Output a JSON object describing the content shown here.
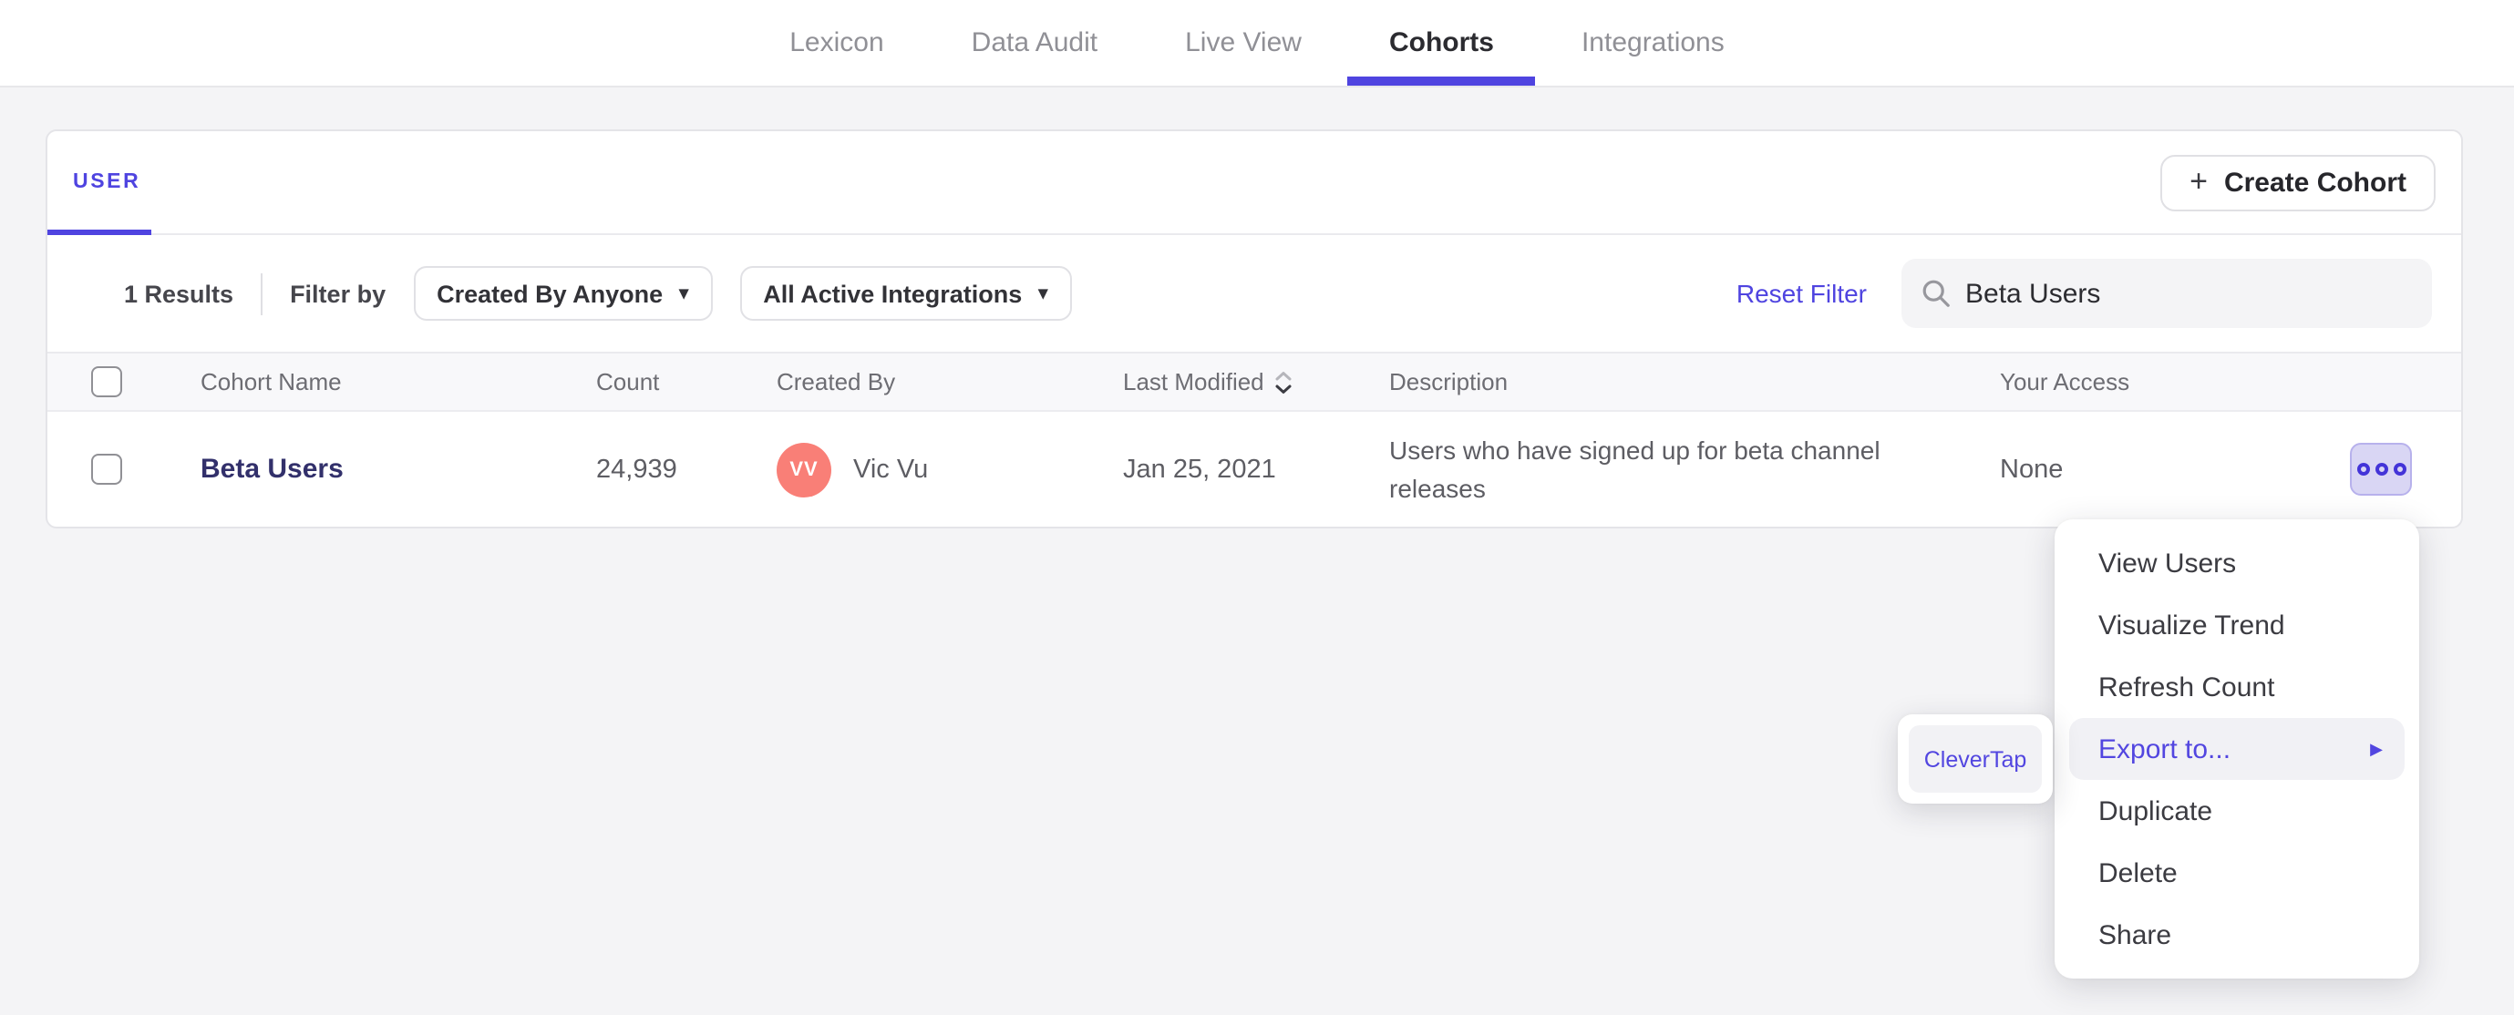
{
  "nav": {
    "items": [
      {
        "label": "Lexicon",
        "active": false
      },
      {
        "label": "Data Audit",
        "active": false
      },
      {
        "label": "Live View",
        "active": false
      },
      {
        "label": "Cohorts",
        "active": true
      },
      {
        "label": "Integrations",
        "active": false
      }
    ]
  },
  "cohorts_card": {
    "tabs": {
      "user_label": "USER"
    },
    "create_button": {
      "plus": "+",
      "label": "Create Cohort"
    },
    "filter_bar": {
      "results_text": "1 Results",
      "filter_by_label": "Filter by",
      "created_by_dropdown": "Created By Anyone",
      "integrations_dropdown": "All Active Integrations",
      "dropdown_caret": "▾",
      "reset_filter_label": "Reset Filter",
      "search_value": "Beta Users"
    },
    "table": {
      "headers": {
        "cohort_name": "Cohort Name",
        "count": "Count",
        "created_by": "Created By",
        "last_modified": "Last Modified",
        "description": "Description",
        "your_access": "Your Access"
      },
      "rows": [
        {
          "name": "Beta Users",
          "count": "24,939",
          "creator_initials": "VV",
          "creator_name": "Vic Vu",
          "last_modified": "Jan 25, 2021",
          "description": "Users who have signed up for beta channel releases",
          "access": "None"
        }
      ]
    }
  },
  "context_menu": {
    "items": [
      {
        "label": "View Users",
        "highlighted": false
      },
      {
        "label": "Visualize Trend",
        "highlighted": false
      },
      {
        "label": "Refresh Count",
        "highlighted": false
      },
      {
        "label": "Export to...",
        "highlighted": true,
        "has_submenu": true,
        "arrow": "▶"
      },
      {
        "label": "Duplicate",
        "highlighted": false
      },
      {
        "label": "Delete",
        "highlighted": false
      },
      {
        "label": "Share",
        "highlighted": false
      }
    ]
  },
  "export_submenu": {
    "items": [
      {
        "label": "CleverTap"
      }
    ]
  },
  "colors": {
    "accent": "#4f44e0",
    "page_bg": "#f4f4f6",
    "card_border": "#e4e4e8",
    "avatar_bg": "#f97f77",
    "ooo_button_bg": "#d9d6f4",
    "ooo_button_border": "#b7b1ec",
    "menu_highlight_bg": "#f1f1f5"
  }
}
